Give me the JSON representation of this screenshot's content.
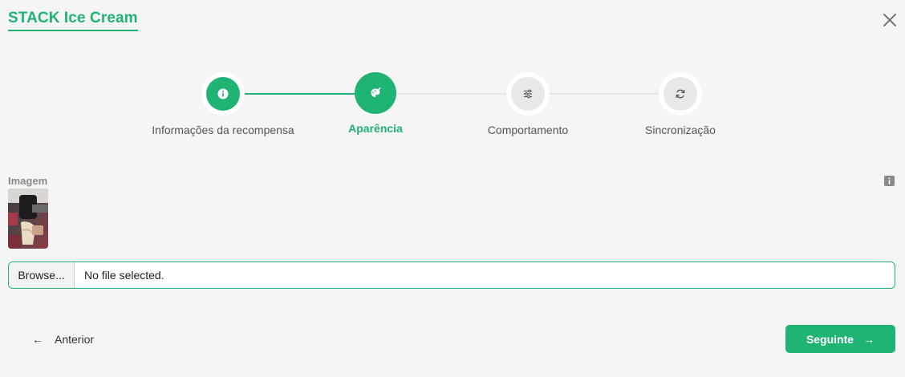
{
  "header": {
    "title": "STACK Ice Cream",
    "close_icon": "close-icon"
  },
  "colors": {
    "accent": "#1fb374",
    "inactive_step": "#e6e8ea",
    "background": "#f4f5f4"
  },
  "stepper": {
    "steps": [
      {
        "label": "Informações da recompensa",
        "icon": "info-icon",
        "state": "done"
      },
      {
        "label": "Aparência",
        "icon": "palette-icon",
        "state": "active"
      },
      {
        "label": "Comportamento",
        "icon": "sliders-icon",
        "state": "inactive"
      },
      {
        "label": "Sincronização",
        "icon": "sync-icon",
        "state": "inactive"
      }
    ]
  },
  "image_field": {
    "label": "Imagem",
    "help_icon": "info-icon"
  },
  "file_input": {
    "button_label": "Browse...",
    "status": "No file selected."
  },
  "footer": {
    "prev_label": "Anterior",
    "prev_icon": "arrow-left-icon",
    "next_label": "Seguinte",
    "next_icon": "arrow-right-icon"
  }
}
